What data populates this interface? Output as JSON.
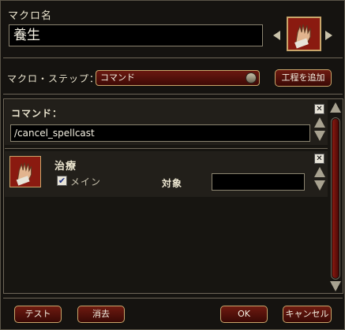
{
  "macro_name": {
    "label": "マクロ名",
    "value": "養生"
  },
  "macro_icon": {
    "name": "hand-spell-icon"
  },
  "step": {
    "label": "マクロ・ステップ：",
    "dropdown_value": "コマンド",
    "add_button": "工程を追加"
  },
  "command_row": {
    "label": "コマンド：",
    "value": "/cancel_spellcast"
  },
  "ability_row": {
    "name": "治療",
    "icon": "hand-spell-icon",
    "checkbox_label": "メイン",
    "checkbox_checked": true,
    "target_label": "対象",
    "target_value": ""
  },
  "footer": {
    "test": "テスト",
    "clear": "消去",
    "ok": "OK",
    "cancel": "キャンセル"
  },
  "colors": {
    "accent_gold": "#c9a56a",
    "button_red": "#6e1a10",
    "panel_bg": "#1b1915"
  }
}
